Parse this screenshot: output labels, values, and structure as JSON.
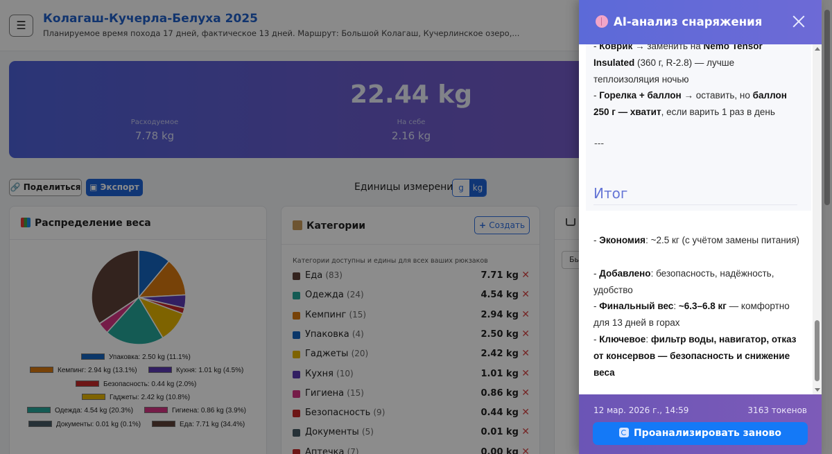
{
  "trip": {
    "title": "Колагаш-Кучерла-Белуха 2025",
    "subtitle": "Планируемое время похода 17 дней, фактическое 13 дней. Маршрут: Большой Колагаш, Кучерлинское озеро,..."
  },
  "summary": {
    "total": "22.44 kg",
    "consumable_label": "Расходуемое",
    "consumable_value": "7.78 kg",
    "worn_label": "На себе",
    "worn_value": "2.16 kg"
  },
  "toolbar": {
    "share_label": "Поделиться",
    "export_label": "Экспорт",
    "units_label": "Единицы измерения:",
    "unit_g": "g",
    "unit_kg": "kg",
    "active_unit": "kg"
  },
  "weight_card": {
    "title": "Распределение веса"
  },
  "chart_data": {
    "type": "pie",
    "title": "",
    "slices": [
      {
        "label": "Упаковка: 2.50 kg (11.1%)",
        "value": 11.1,
        "color": "#1565c0"
      },
      {
        "label": "Кемпинг: 2.94 kg (13.1%)",
        "value": 13.1,
        "color": "#d9790f"
      },
      {
        "label": "Кухня: 1.01 kg (4.5%)",
        "value": 4.5,
        "color": "#5b3ab3"
      },
      {
        "label": "Безопасность: 0.44 kg (2.0%)",
        "value": 2.0,
        "color": "#c62828"
      },
      {
        "label": "Гаджеты: 2.42 kg (10.8%)",
        "value": 10.8,
        "color": "#e6b500"
      },
      {
        "label": "Одежда: 4.54 kg (20.3%)",
        "value": 20.3,
        "color": "#26a69a"
      },
      {
        "label": "Гигиена: 0.86 kg (3.9%)",
        "value": 3.9,
        "color": "#d63384"
      },
      {
        "label": "Документы: 0.01 kg (0.1%)",
        "value": 0.1,
        "color": "#455a64"
      },
      {
        "label": "Еда: 7.71 kg (34.4%)",
        "value": 34.4,
        "color": "#5d4037"
      }
    ]
  },
  "categories_card": {
    "title": "Категории",
    "create_label": "Создать",
    "note": "Категории доступны и едины для всех ваших рюкзаков",
    "items": [
      {
        "name": "Еда",
        "count": "(83)",
        "weight": "7.71 kg",
        "color": "#5d4037"
      },
      {
        "name": "Одежда",
        "count": "(24)",
        "weight": "4.54 kg",
        "color": "#26a69a"
      },
      {
        "name": "Кемпинг",
        "count": "(15)",
        "weight": "2.94 kg",
        "color": "#d9790f"
      },
      {
        "name": "Упаковка",
        "count": "(4)",
        "weight": "2.50 kg",
        "color": "#1565c0"
      },
      {
        "name": "Гаджеты",
        "count": "(20)",
        "weight": "2.42 kg",
        "color": "#e6b500"
      },
      {
        "name": "Кухня",
        "count": "(10)",
        "weight": "1.01 kg",
        "color": "#5b3ab3"
      },
      {
        "name": "Гигиена",
        "count": "(15)",
        "weight": "0.86 kg",
        "color": "#d63384"
      },
      {
        "name": "Безопасность",
        "count": "(9)",
        "weight": "0.44 kg",
        "color": "#c62828"
      },
      {
        "name": "Документы",
        "count": "(5)",
        "weight": "0.01 kg",
        "color": "#455a64"
      },
      {
        "name": "Аптечка",
        "count": "(7)",
        "weight": "0.00 kg",
        "color": "#c62828"
      }
    ],
    "delete_glyph": "✕"
  },
  "third_card": {
    "partial_text": "Бь"
  },
  "drawer": {
    "title": "AI-анализ снаряжения",
    "lines": {
      "mat_b1": "Коврик",
      "mat_t1": " → заменить на ",
      "mat_b2": "Nemo Tensor Insulated",
      "mat_t2": " (360 г, R-2.8) — лучше теплоизоляция ночью",
      "burner_b1": "Горелка + баллон",
      "burner_t1": " → оставить, но ",
      "burner_b2": "баллон 250 г — хватит",
      "burner_t2": ", если варить 1 раз в день",
      "divider": "---",
      "summary_heading": "Итог",
      "econ_b": "Экономия",
      "econ_t": ": ~2.5 кг (с учётом замены питания)",
      "added_b": "Добавлено",
      "added_t": ": безопасность, надёжность, удобство",
      "final_b1": "Финальный вес",
      "final_t1": ": ",
      "final_b2": "~6.3–6.8 кг",
      "final_t2": " — комфортно для 13 дней в горах",
      "key_b1": "Ключевое",
      "key_t1": ": ",
      "key_b2": "фильтр воды, навигатор, отказ от консервов — безопасность и снижение веса",
      "dash": "- "
    },
    "footer_date": "12 мар. 2026 г., 14:59",
    "footer_tokens": "3163 токенов",
    "reanalyze_label": "Проанализировать заново"
  }
}
